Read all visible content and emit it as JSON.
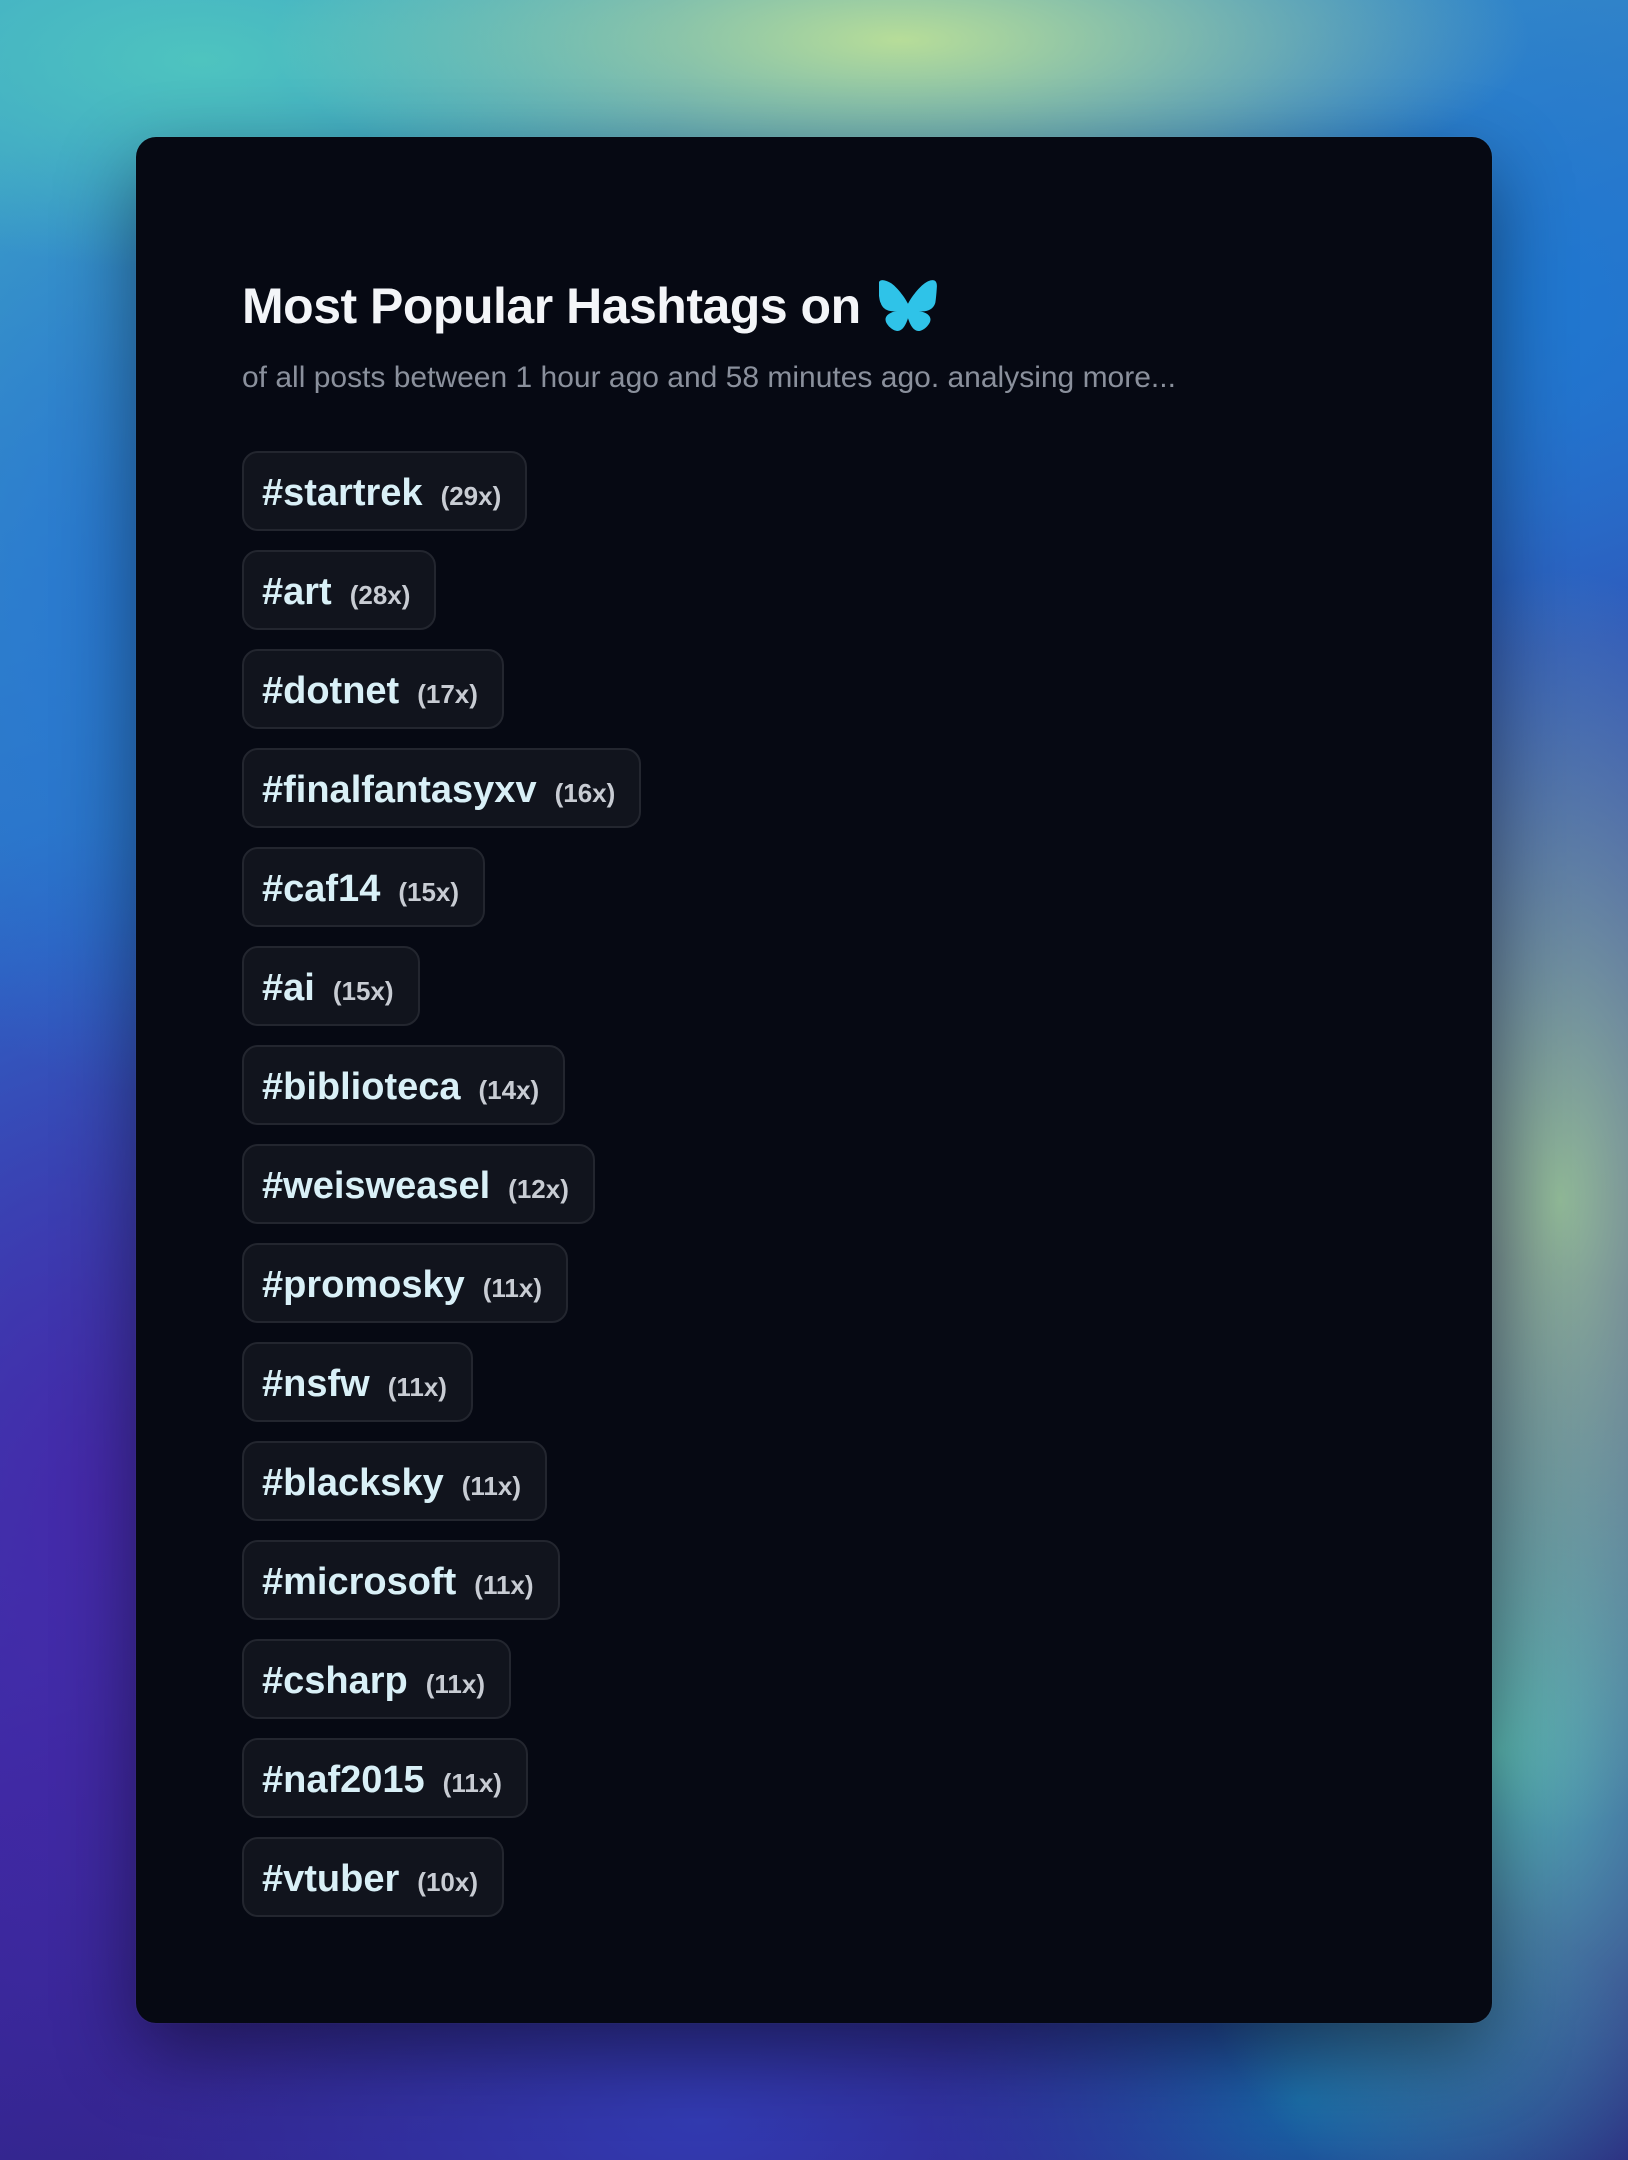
{
  "header": {
    "title": "Most Popular Hashtags on",
    "logo_icon": "butterfly-icon",
    "logo_color": "#2fc3e8",
    "subtitle": "of all posts between 1 hour ago and 58 minutes ago. analysing more..."
  },
  "hashtags": [
    {
      "tag": "#startrek",
      "count": "(29x)"
    },
    {
      "tag": "#art",
      "count": "(28x)"
    },
    {
      "tag": "#dotnet",
      "count": "(17x)"
    },
    {
      "tag": "#finalfantasyxv",
      "count": "(16x)"
    },
    {
      "tag": "#caf14",
      "count": "(15x)"
    },
    {
      "tag": "#ai",
      "count": "(15x)"
    },
    {
      "tag": "#biblioteca",
      "count": "(14x)"
    },
    {
      "tag": "#weisweasel",
      "count": "(12x)"
    },
    {
      "tag": "#promosky",
      "count": "(11x)"
    },
    {
      "tag": "#nsfw",
      "count": "(11x)"
    },
    {
      "tag": "#blacksky",
      "count": "(11x)"
    },
    {
      "tag": "#microsoft",
      "count": "(11x)"
    },
    {
      "tag": "#csharp",
      "count": "(11x)"
    },
    {
      "tag": "#naf2015",
      "count": "(11x)"
    },
    {
      "tag": "#vtuber",
      "count": "(10x)"
    }
  ],
  "colors": {
    "card_background": "#060913",
    "tag_background": "#11141d",
    "tag_text": "#d9f0f7",
    "count_text": "#c8ccd3",
    "subtitle_text": "#8a909c"
  }
}
